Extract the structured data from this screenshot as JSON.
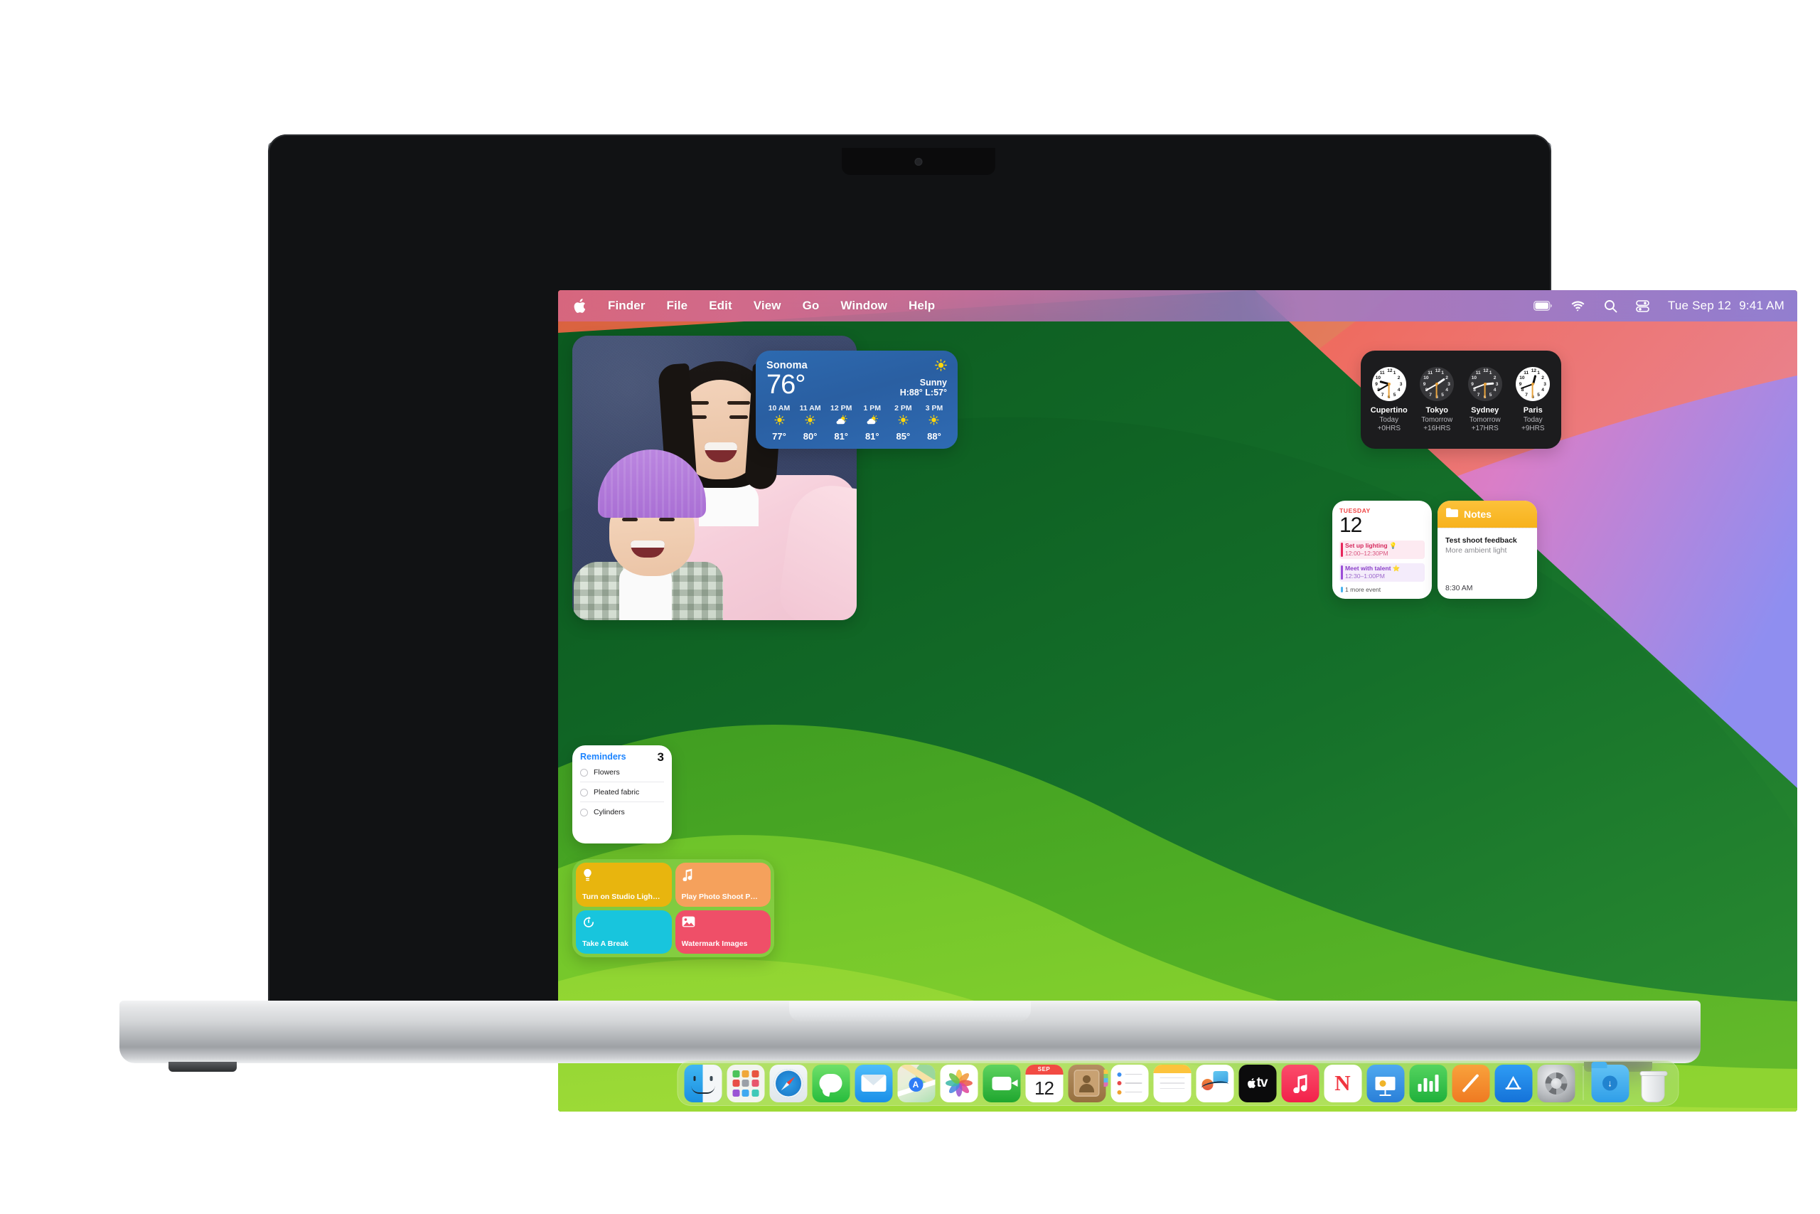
{
  "menubar": {
    "apple_icon": "apple-logo-icon",
    "items": [
      "Finder",
      "File",
      "Edit",
      "View",
      "Go",
      "Window",
      "Help"
    ],
    "status_icons": [
      "battery-icon",
      "wifi-icon",
      "search-icon",
      "control-center-icon"
    ],
    "date": "Tue Sep 12",
    "time": "9:41 AM"
  },
  "widgets": {
    "photo": {
      "name": "photo-widget",
      "description": "Photo of a woman and child smiling in front of a blue wall"
    },
    "weather": {
      "city": "Sonoma",
      "temperature": "76°",
      "condition": "Sunny",
      "high_low": "H:88° L:57°",
      "condition_icon": "sun-icon",
      "hourly": [
        {
          "hour": "10 AM",
          "icon": "sun-icon",
          "temp": "77°"
        },
        {
          "hour": "11 AM",
          "icon": "sun-icon",
          "temp": "80°"
        },
        {
          "hour": "12 PM",
          "icon": "sun-cloud-icon",
          "temp": "81°"
        },
        {
          "hour": "1 PM",
          "icon": "sun-cloud-icon",
          "temp": "81°"
        },
        {
          "hour": "2 PM",
          "icon": "sun-icon",
          "temp": "85°"
        },
        {
          "hour": "3 PM",
          "icon": "sun-icon",
          "temp": "88°"
        }
      ]
    },
    "world_clock": {
      "clocks": [
        {
          "city": "Cupertino",
          "day": "Today",
          "offset": "+0HRS",
          "theme": "light",
          "hour_deg": 285,
          "minute_deg": 240,
          "second_deg": 180
        },
        {
          "city": "Tokyo",
          "day": "Tomorrow",
          "offset": "+16HRS",
          "theme": "dark",
          "hour_deg": 55,
          "minute_deg": 240,
          "second_deg": 180
        },
        {
          "city": "Sydney",
          "day": "Tomorrow",
          "offset": "+17HRS",
          "theme": "dark",
          "hour_deg": 85,
          "minute_deg": 250,
          "second_deg": 180
        },
        {
          "city": "Paris",
          "day": "Today",
          "offset": "+9HRS",
          "theme": "light",
          "hour_deg": 15,
          "minute_deg": 250,
          "second_deg": 180
        }
      ]
    },
    "calendar": {
      "day_of_week": "TUESDAY",
      "day_number": "12",
      "events": [
        {
          "title": "Set up lighting 💡",
          "time": "12:00–12:30PM",
          "bar_color": "#e8245a",
          "bg_color": "#fdeaf1",
          "text_color": "#d62a5e"
        },
        {
          "title": "Meet with talent ⭐",
          "time": "12:30–1:00PM",
          "bar_color": "#9b4dd8",
          "bg_color": "#f4ecfb",
          "text_color": "#8a3fc9"
        }
      ],
      "more_events": "1 more event"
    },
    "notes": {
      "header": "Notes",
      "header_icon": "folder-icon",
      "title": "Test shoot feedback",
      "subtitle": "More ambient light",
      "time": "8:30 AM",
      "accent": "#fbc02d"
    },
    "reminders": {
      "title": "Reminders",
      "count": "3",
      "accent": "#1c84ff",
      "items": [
        "Flowers",
        "Pleated fabric",
        "Cylinders"
      ]
    },
    "shortcuts": {
      "tiles": [
        {
          "label": "Turn on Studio Ligh…",
          "icon": "lightbulb-icon",
          "color": "#e8b50e"
        },
        {
          "label": "Play Photo Shoot P…",
          "icon": "music-note-icon",
          "color": "#f5a15c"
        },
        {
          "label": "Take A Break",
          "icon": "timer-icon",
          "color": "#18c5dd"
        },
        {
          "label": "Watermark Images",
          "icon": "photo-icon",
          "color": "#ef4f68"
        }
      ]
    }
  },
  "dock": {
    "items": [
      {
        "name": "finder",
        "label": "Finder",
        "running": true
      },
      {
        "name": "launchpad",
        "label": "Launchpad",
        "running": false
      },
      {
        "name": "safari",
        "label": "Safari",
        "running": false
      },
      {
        "name": "messages",
        "label": "Messages",
        "running": false
      },
      {
        "name": "mail",
        "label": "Mail",
        "running": false
      },
      {
        "name": "maps",
        "label": "Maps",
        "running": false
      },
      {
        "name": "photos",
        "label": "Photos",
        "running": false
      },
      {
        "name": "facetime",
        "label": "FaceTime",
        "running": false
      },
      {
        "name": "calendar",
        "label": "Calendar",
        "running": false,
        "month": "SEP",
        "day": "12"
      },
      {
        "name": "contacts",
        "label": "Contacts",
        "running": false
      },
      {
        "name": "reminders",
        "label": "Reminders",
        "running": false
      },
      {
        "name": "notes",
        "label": "Notes",
        "running": false
      },
      {
        "name": "freeform",
        "label": "Freeform",
        "running": false
      },
      {
        "name": "tv",
        "label": "TV",
        "running": false,
        "text": "tv"
      },
      {
        "name": "music",
        "label": "Music",
        "running": false
      },
      {
        "name": "news",
        "label": "News",
        "running": false,
        "text": "N"
      },
      {
        "name": "keynote",
        "label": "Keynote",
        "running": false
      },
      {
        "name": "numbers",
        "label": "Numbers",
        "running": false
      },
      {
        "name": "pages",
        "label": "Pages",
        "running": false
      },
      {
        "name": "app-store",
        "label": "App Store",
        "running": false
      },
      {
        "name": "system-settings",
        "label": "System Settings",
        "running": false
      }
    ],
    "downloads_label": "Downloads",
    "trash_label": "Trash"
  }
}
